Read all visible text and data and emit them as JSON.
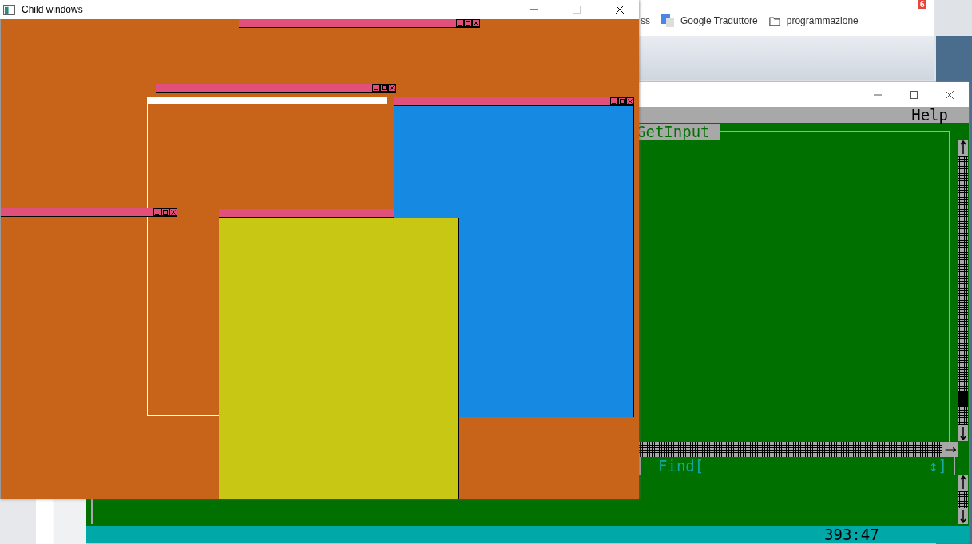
{
  "browser": {
    "badge": "6",
    "bookmarks": [
      {
        "label": "ss",
        "kind": "text"
      },
      {
        "label": "Google Traduttore",
        "kind": "translate"
      },
      {
        "label": "programmazione",
        "kind": "folder"
      }
    ]
  },
  "child_windows": {
    "title": "Child windows",
    "children": [
      {
        "kind": "window"
      },
      {
        "kind": "window"
      },
      {
        "kind": "outline"
      },
      {
        "kind": "window",
        "color": "#168ae2"
      },
      {
        "kind": "window"
      },
      {
        "kind": "window",
        "color": "#c8c814"
      }
    ]
  },
  "console": {
    "menu": [
      {
        "label": "Help"
      }
    ],
    "editor_title": "GetInput",
    "find_label": "Find[",
    "find_end": "↕]",
    "status": "393:47"
  }
}
